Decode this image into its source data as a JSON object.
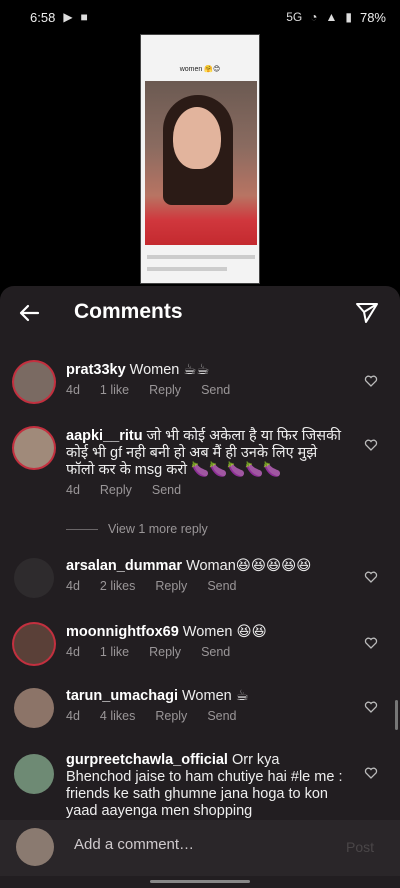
{
  "status_bar": {
    "time": "6:58",
    "battery": "78%",
    "network": "5G"
  },
  "preview": {
    "caption": "women 🤗😊"
  },
  "header": {
    "title": "Comments"
  },
  "comments": [
    {
      "username": "prat33ky",
      "text": "Women ☕☕",
      "age": "4d",
      "likes": "1 like",
      "reply": "Reply",
      "send": "Send"
    },
    {
      "username": "aapki__ritu",
      "text": "जो भी कोई अकेला है या फिर जिसकी कोई भी gf नही बनी हो अब मैं ही उनके लिए मुझे फॉलो कर के msg करो 🍆🍆🍆🍆🍆",
      "age": "4d",
      "likes": "",
      "reply": "Reply",
      "send": "Send"
    },
    {
      "username": "arsalan_dummar",
      "text": "Woman😆😆😆😆😆",
      "age": "4d",
      "likes": "2 likes",
      "reply": "Reply",
      "send": "Send"
    },
    {
      "username": "moonnightfox69",
      "text": "Women 😆😆",
      "age": "4d",
      "likes": "1 like",
      "reply": "Reply",
      "send": "Send"
    },
    {
      "username": "tarun_umachagi",
      "text": "Women ☕",
      "age": "4d",
      "likes": "4 likes",
      "reply": "Reply",
      "send": "Send"
    },
    {
      "username": "gurpreetchawla_official",
      "text": "Orr kya Bhenchod jaise to ham chutiye hai #le me : friends ke sath ghumne jana hoga to kon yaad aayenga men shopping",
      "age": "",
      "likes": "",
      "reply": "",
      "send": ""
    }
  ],
  "view_more": "View 1 more reply",
  "composer": {
    "placeholder": "Add a comment…",
    "post_label": "Post"
  },
  "colors": {
    "panel": "#221e21",
    "ring": "#c3303f",
    "muted": "#9a9698"
  },
  "icons": [
    "back-arrow-icon",
    "send-icon",
    "heart-icon"
  ]
}
